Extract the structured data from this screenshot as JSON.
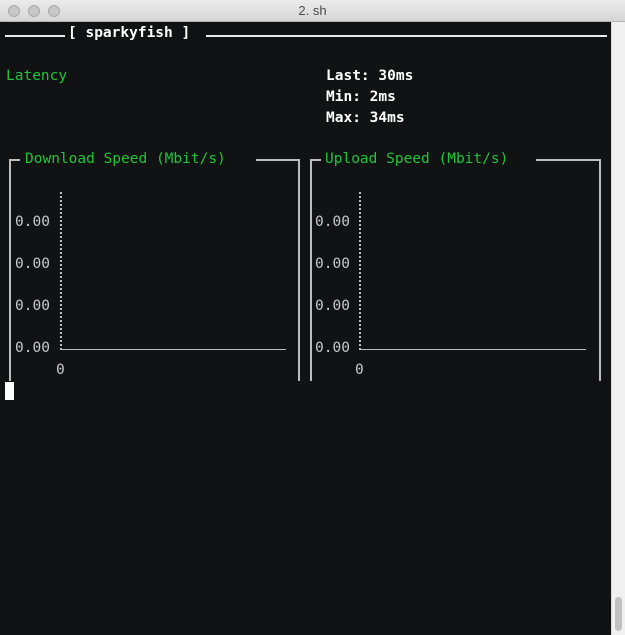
{
  "window": {
    "title": "2. sh"
  },
  "app": {
    "name": "[ sparkyfish ]"
  },
  "latency": {
    "label": "Latency",
    "last": "Last: 30ms",
    "min": "Min: 2ms",
    "max": "Max: 34ms"
  },
  "download": {
    "title": "Download Speed (Mbit/s)",
    "ticks": [
      "0.00",
      "0.00",
      "0.00",
      "0.00"
    ],
    "x_origin": "0"
  },
  "upload": {
    "title": "Upload Speed (Mbit/s)",
    "ticks": [
      "0.00",
      "0.00",
      "0.00",
      "0.00"
    ],
    "x_origin": "0"
  },
  "colors": {
    "terminal_bg": "#111213",
    "accent_green": "#22c33a",
    "text_white": "#ffffff",
    "axis_grey": "#bdbdbd"
  }
}
